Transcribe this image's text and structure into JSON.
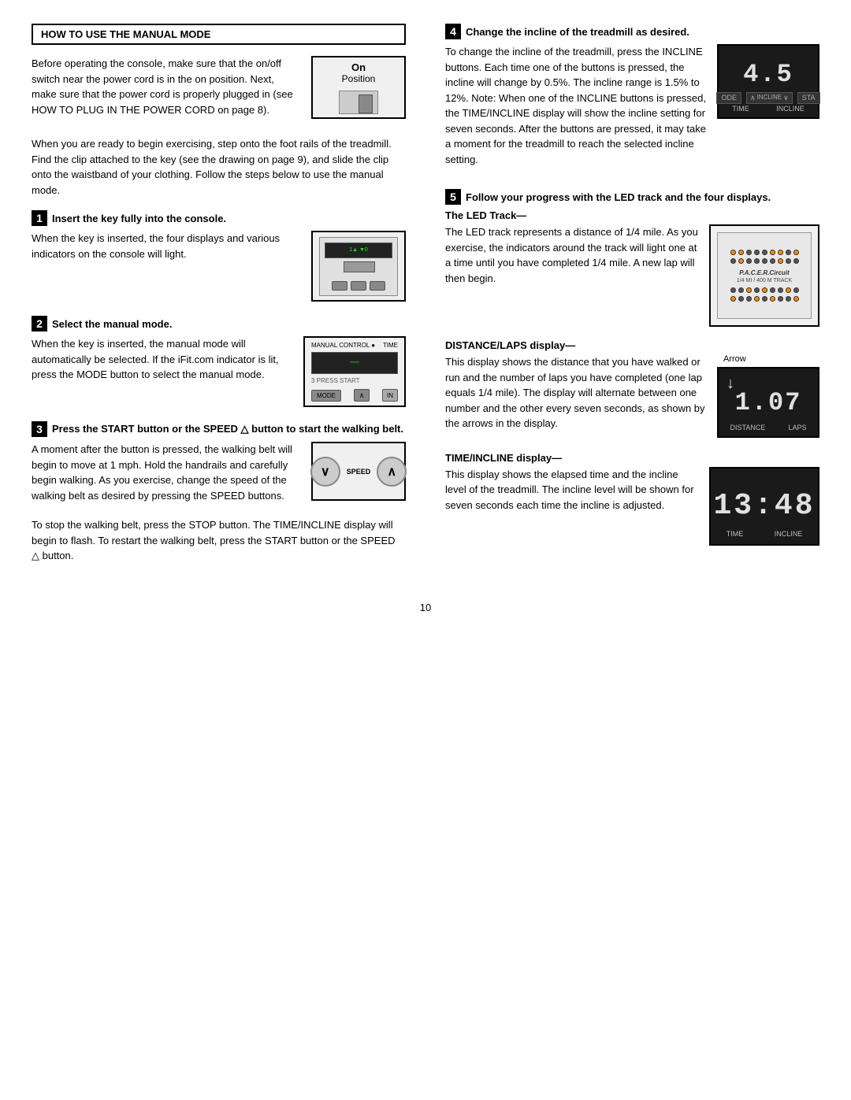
{
  "page": {
    "number": "10",
    "left_col": {
      "heading": "HOW TO USE THE MANUAL MODE",
      "intro": "Before operating the console, make sure that the on/off switch near the power cord is in the on position. Next, make sure that the power cord is properly plugged in (see HOW TO PLUG IN THE POWER CORD on page 8).",
      "intro2": "When you are ready to begin exercising, step onto the foot rails of the treadmill. Find the clip attached to the key (see the drawing on page 9), and slide the clip onto the waistband of your clothing. Follow the steps below to use the manual mode.",
      "on_position_label": "On",
      "on_position_sub": "Position",
      "steps": [
        {
          "number": "1",
          "title": "Insert the key fully into the console.",
          "body": "When the key is inserted, the four displays and various indicators on the console will light."
        },
        {
          "number": "2",
          "title": "Select the manual mode.",
          "body": "When the key is inserted, the manual mode will automatically be selected. If the iFit.com indicator is lit, press the MODE button to select the manual mode."
        },
        {
          "number": "3",
          "title": "Press the START button or the SPEED △ button to start the walking belt.",
          "body": "A moment after the button is pressed, the walking belt will begin to move at 1 mph. Hold the handrails and carefully begin walking. As you exercise, change the speed of the walking belt as desired by pressing the SPEED buttons.",
          "body2": "To stop the walking belt, press the STOP button. The TIME/INCLINE display will begin to flash. To restart the walking belt, press the START button or the SPEED △ button."
        }
      ]
    },
    "right_col": {
      "step4": {
        "number": "4",
        "title": "Change the incline of the treadmill as desired.",
        "body": "To change the incline of the treadmill, press the INCLINE buttons. Each time one of the buttons is pressed, the incline will change by 0.5%. The incline range is 1.5% to 12%. Note: When one of the INCLINE buttons is pressed, the TIME/INCLINE display will show the incline setting for seven seconds. After the buttons are pressed, it may take a moment for the treadmill to reach the selected incline setting.",
        "display": {
          "value": "4.5",
          "label_left": "TIME",
          "label_right": "INCLINE"
        }
      },
      "step5": {
        "number": "5",
        "title": "Follow your progress with the LED track and the four displays.",
        "led_track": {
          "title": "The LED Track—",
          "body": "The LED track represents a distance of 1/4 mile. As you exercise, the indicators around the track will light one at a time until you have completed 1/4 mile. A new lap will then begin.",
          "pacer_label": "P.A.C.E.R.Circuit",
          "pacer_sub": "1/4 MI / 400 M TRACK"
        },
        "distance": {
          "title": "DISTANCE/LAPS display",
          "dash": "—",
          "body": "This display shows the distance that you have walked or run and the number of laps you have completed (one lap equals 1/4 mile). The display will alternate between one number and the other every seven seconds, as shown by the arrows in the display.",
          "value": "1.07",
          "label_left": "DISTANCE",
          "label_right": "LAPS",
          "arrow_label": "Arrow"
        },
        "time_incline": {
          "title": "TIME/INCLINE display",
          "dash": "—",
          "body": "This display shows the elapsed time and the incline level of the treadmill. The incline level will be shown for seven seconds each time the incline is adjusted.",
          "value": "13:48",
          "label_left": "TIME",
          "label_right": "INCLINE"
        }
      }
    }
  }
}
